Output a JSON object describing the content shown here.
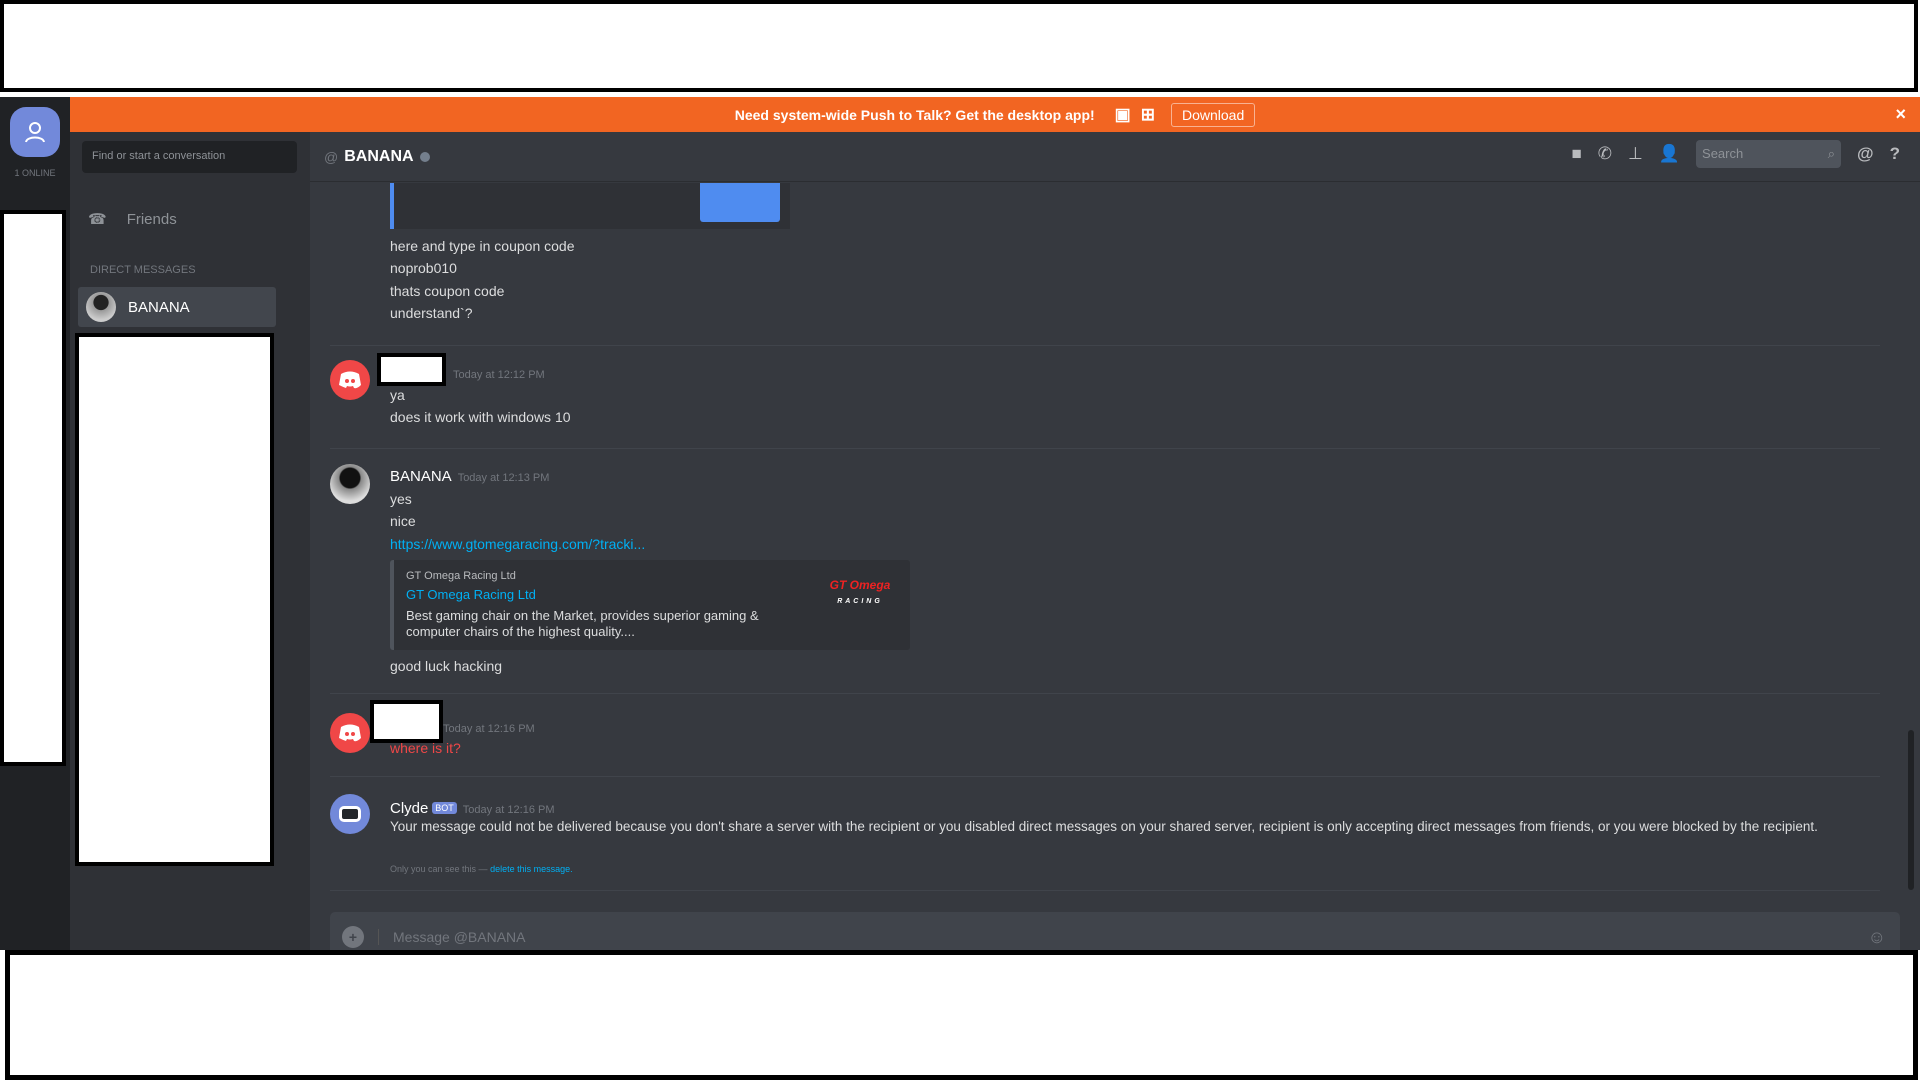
{
  "banner": {
    "text": "Need system-wide Push to Talk? Get the desktop app!",
    "download": "Download",
    "close": "×",
    "color": "#f26522"
  },
  "servers": {
    "online": "1 ONLINE"
  },
  "sidebar": {
    "search_placeholder": "Find or start a conversation",
    "friends": "Friends",
    "dm_header": "DIRECT MESSAGES",
    "dms": [
      {
        "name": "BANANA"
      }
    ]
  },
  "header": {
    "at": "@",
    "channel": "BANANA",
    "search_placeholder": "Search",
    "mention": "@",
    "help": "?"
  },
  "messages": {
    "first_group": {
      "lines": [
        "here and type in coupon code",
        "noprob010",
        "thats coupon code",
        "understand`?"
      ]
    },
    "group2": {
      "time": "Today at 12:12 PM",
      "lines": [
        "ya",
        "does it work with windows 10"
      ]
    },
    "group3": {
      "author": "BANANA",
      "time": "Today at 12:13 PM",
      "lines": [
        "yes",
        "nice"
      ],
      "link": "https://www.gtomegaracing.com/?tracki...",
      "embed": {
        "provider": "GT Omega Racing Ltd",
        "title": "GT Omega Racing Ltd",
        "description": "Best gaming chair on the Market, provides superior gaming & computer chairs of the highest quality....",
        "logo": "GT Omega RACING"
      },
      "after": "good luck hacking"
    },
    "group4": {
      "time": "Today at 12:16 PM",
      "text": "where is it?"
    },
    "group5": {
      "author": "Clyde",
      "badge": "BOT",
      "time": "Today at 12:16 PM",
      "text": "Your message could not be delivered because you don't share a server with the recipient or you disabled direct messages on your shared server, recipient is only accepting direct messages from friends, or you were blocked by the recipient.",
      "note": "Only you can see this —",
      "delete": "delete this message."
    }
  },
  "composer": {
    "placeholder": "Message @BANANA"
  }
}
